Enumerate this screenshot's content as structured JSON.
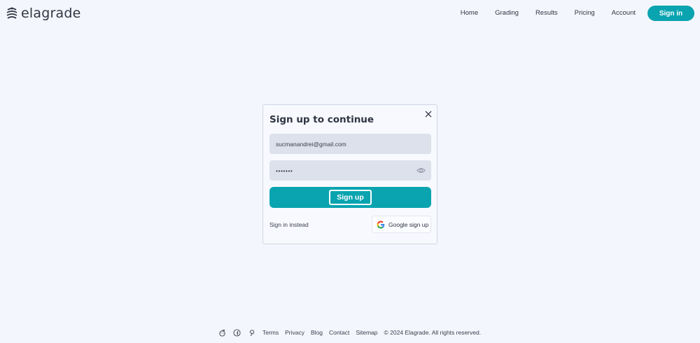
{
  "header": {
    "logo_text": "elagrade",
    "nav": [
      "Home",
      "Grading",
      "Results",
      "Pricing",
      "Account"
    ],
    "signin_label": "Sign in"
  },
  "modal": {
    "title": "Sign up to continue",
    "email_value": "sucmanandrei@gmail.com",
    "password_value": "•••••••",
    "signup_label": "Sign up",
    "signin_instead_label": "Sign in instead",
    "google_label": "Google sign up"
  },
  "footer": {
    "social_icons": [
      "reddit-icon",
      "facebook-icon",
      "pinterest-icon"
    ],
    "links": [
      "Terms",
      "Privacy",
      "Blog",
      "Contact",
      "Sitemap"
    ],
    "copyright": "© 2024 Elagrade. All rights reserved."
  },
  "colors": {
    "accent": "#0aa4b0",
    "background": "#f4f6fd",
    "field": "#dce1ec"
  }
}
